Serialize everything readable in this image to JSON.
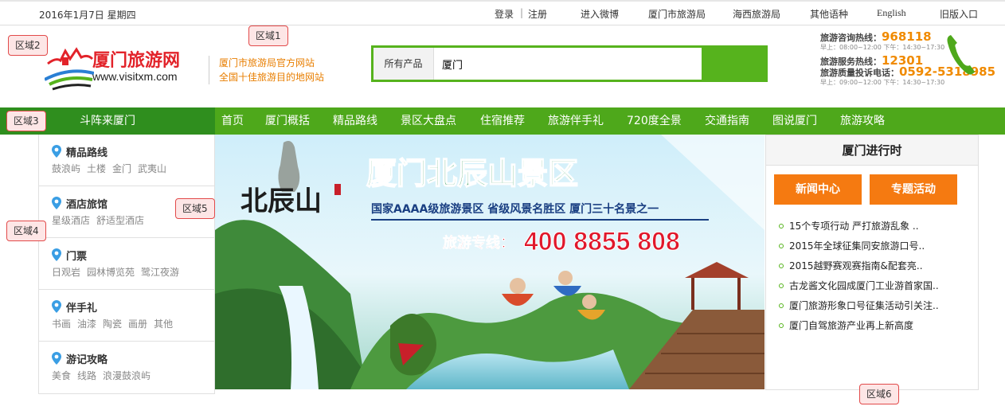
{
  "topbar": {
    "date": "2016年1月7日 星期四",
    "login": "登录",
    "sep": "|",
    "register": "注册",
    "weibo": "进入微博",
    "bureau": "厦门市旅游局",
    "haixi": "海西旅游局",
    "languages": "其他语种",
    "english": "English",
    "old_version": "旧版入口"
  },
  "header": {
    "logo_text": "厦门旅游网",
    "logo_url": "www.visitxm.com",
    "slogan_line1": "厦门市旅游局官方网站",
    "slogan_line2": "全国十佳旅游目的地网站"
  },
  "search": {
    "category": "所有产品",
    "value": "厦门"
  },
  "hotlines": {
    "consult_label": "旅游咨询热线：",
    "consult_number": "968118",
    "consult_hours": "早上：08:00~12:00  下午：14:30~17:30",
    "service_label": "旅游服务热线：",
    "service_number": "12301",
    "complaint_label": "旅游质量投诉电话：",
    "complaint_number": "0592-5318985",
    "complaint_hours": "早上：09:00~12:00  下午：14:30~17:30"
  },
  "nav": {
    "category_label": "斗阵来厦门",
    "items": [
      "首页",
      "厦门概括",
      "精品路线",
      "景区大盘点",
      "住宿推荐",
      "旅游伴手礼",
      "720度全景",
      "交通指南",
      "图说厦门",
      "旅游攻略"
    ]
  },
  "sidebar": {
    "sections": [
      {
        "title": "精品路线",
        "links": [
          "鼓浪屿",
          "土楼",
          "金门",
          "武夷山"
        ]
      },
      {
        "title": "酒店旅馆",
        "links": [
          "星级酒店",
          "舒适型酒店"
        ]
      },
      {
        "title": "门票",
        "links": [
          "日观岩",
          "园林博览苑",
          "鹭江夜游"
        ]
      },
      {
        "title": "伴手礼",
        "links": [
          "书画",
          "油漆",
          "陶瓷",
          "画册",
          "其他"
        ]
      },
      {
        "title": "游记攻略",
        "links": [
          "美食",
          "线路",
          "浪漫鼓浪屿"
        ]
      }
    ]
  },
  "banner": {
    "calligraphy": "北辰山",
    "title": "厦门北辰山景区",
    "subtitle": "国家AAAA级旅游景区   省级风景名胜区   厦门三十名景之一",
    "hotline_label": "旅游专线：",
    "hotline_number": "400 8855 808"
  },
  "news": {
    "header": "厦门进行时",
    "btn_news": "新闻中心",
    "btn_topics": "专题活动",
    "items": [
      "15个专项行动  严打旅游乱象  ..",
      "2015年全球征集同安旅游口号..",
      "2015越野赛观赛指南&配套亮..",
      "古龙酱文化园成厦门工业游首家国..",
      "厦门旅游形象口号征集活动引关注..",
      "厦门自驾旅游产业再上新高度"
    ]
  },
  "regions": {
    "r1": "区域1",
    "r2": "区域2",
    "r3": "区域3",
    "r4": "区域4",
    "r5": "区域5",
    "r6": "区域6"
  },
  "colors": {
    "nav_green": "#4ea81b",
    "nav_dark_green": "#2f8e1e",
    "accent_orange": "#f57a11",
    "hotline_orange": "#f08a00",
    "banner_title_green": "#0f8a3a",
    "banner_hotline_red": "#e0182b"
  }
}
